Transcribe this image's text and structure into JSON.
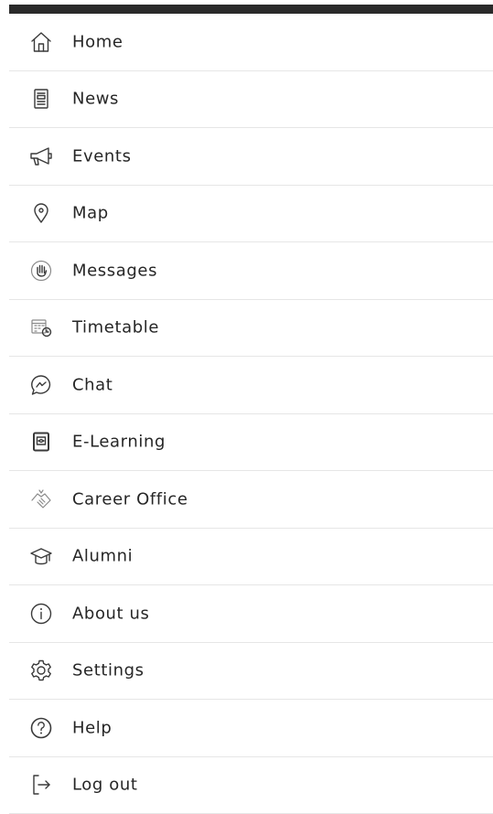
{
  "menu": {
    "items": [
      {
        "label": "Home",
        "icon": "home-icon"
      },
      {
        "label": "News",
        "icon": "news-icon"
      },
      {
        "label": "Events",
        "icon": "megaphone-icon"
      },
      {
        "label": "Map",
        "icon": "map-pin-icon"
      },
      {
        "label": "Messages",
        "icon": "hand-icon"
      },
      {
        "label": "Timetable",
        "icon": "calendar-clock-icon"
      },
      {
        "label": "Chat",
        "icon": "chat-bubble-icon"
      },
      {
        "label": "E-Learning",
        "icon": "tablet-icon"
      },
      {
        "label": "Career Office",
        "icon": "handshake-icon"
      },
      {
        "label": "Alumni",
        "icon": "graduation-cap-icon"
      },
      {
        "label": "About us",
        "icon": "info-icon"
      },
      {
        "label": "Settings",
        "icon": "gear-icon"
      },
      {
        "label": "Help",
        "icon": "help-icon"
      },
      {
        "label": "Log out",
        "icon": "logout-icon"
      }
    ]
  },
  "colors": {
    "top_bar": "#2a2a2a",
    "divider": "#e6e6e6",
    "text": "#262626"
  }
}
